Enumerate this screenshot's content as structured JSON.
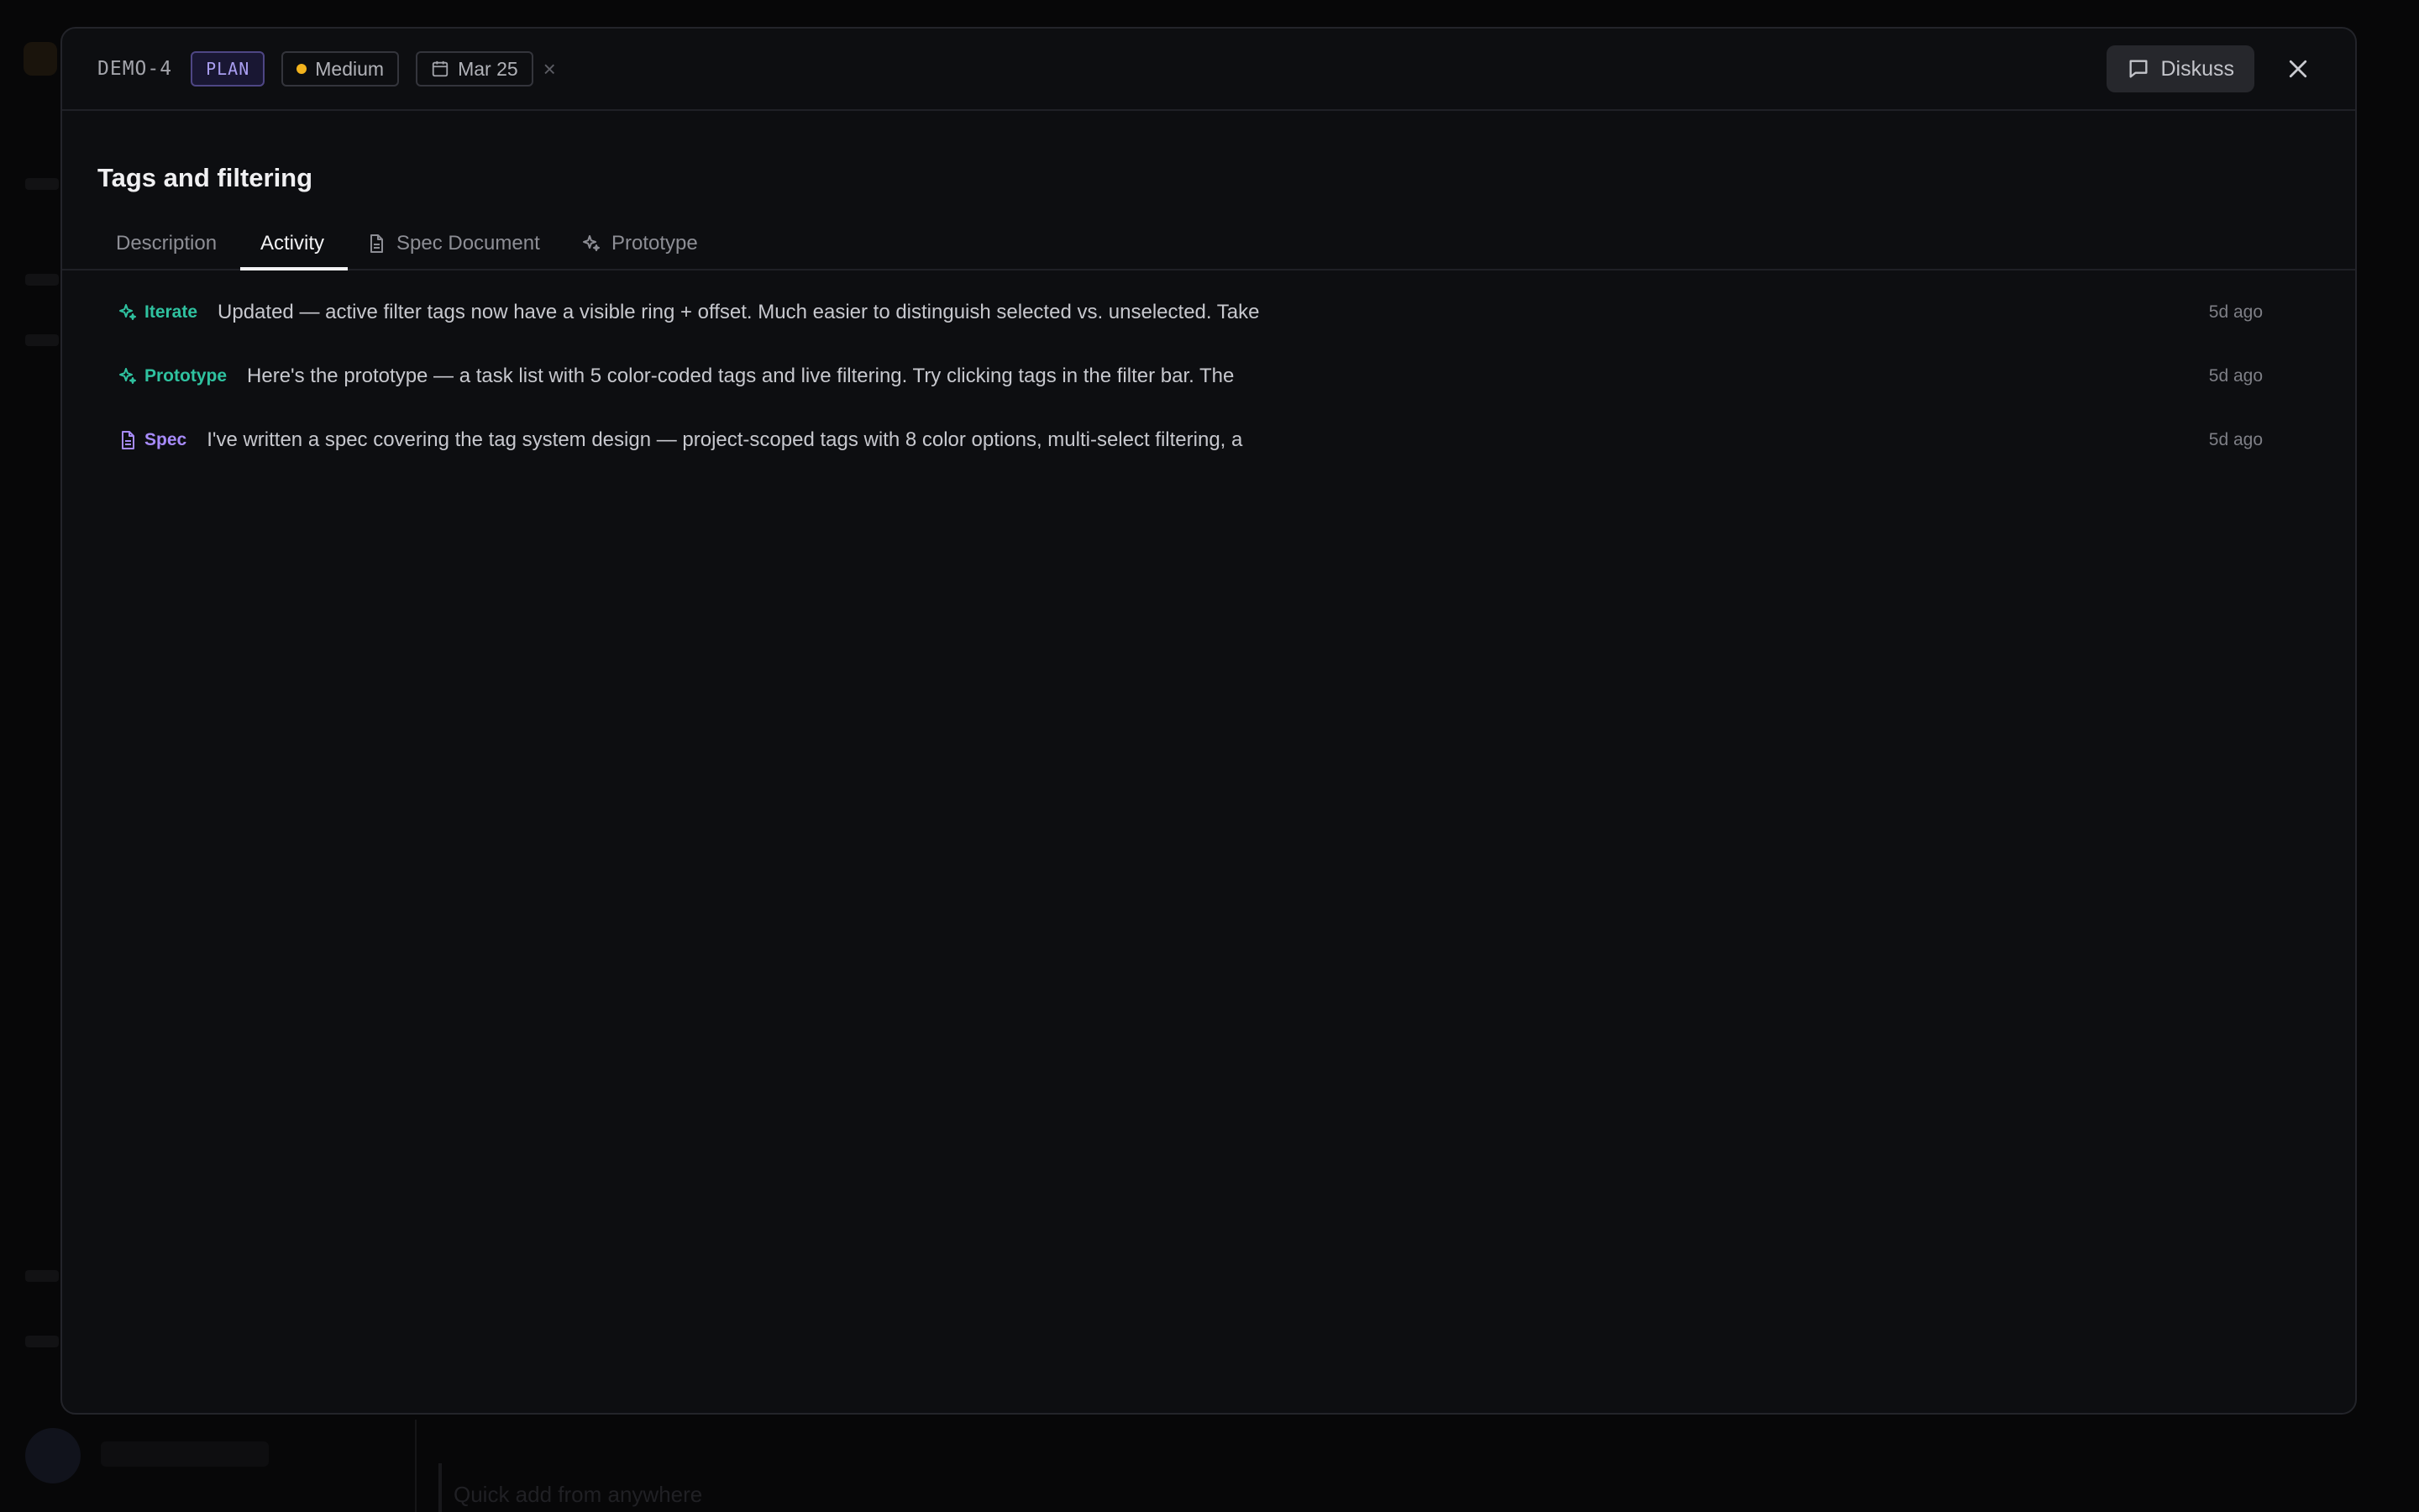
{
  "background": {
    "quick_add_text": "Quick add from anywhere"
  },
  "modal": {
    "issue_id": "DEMO-4",
    "stage_badge": "PLAN",
    "priority": {
      "label": "Medium",
      "color": "#f2b31d"
    },
    "due_date": {
      "label": "Mar 25",
      "icon": "calendar-icon",
      "clear_symbol": "×"
    },
    "discuss_button": {
      "label": "Diskuss",
      "icon": "message-square-icon"
    },
    "close_icon": "close-icon",
    "title": "Tags and filtering",
    "tabs": [
      {
        "label": "Description",
        "icon": null,
        "active": false
      },
      {
        "label": "Activity",
        "icon": null,
        "active": true
      },
      {
        "label": "Spec Document",
        "icon": "document-icon",
        "active": false
      },
      {
        "label": "Prototype",
        "icon": "sparkles-icon",
        "active": false
      }
    ],
    "activity": [
      {
        "type": "Iterate",
        "icon": "sparkles-icon",
        "color": "#2fc2a0",
        "text": "Updated — active filter tags now have a visible ring + offset. Much easier to distinguish selected vs. unselected. Take",
        "time": "5d ago"
      },
      {
        "type": "Prototype",
        "icon": "sparkles-icon",
        "color": "#2fc2a0",
        "text": "Here's the prototype — a task list with 5 color-coded tags and live filtering. Try clicking tags in the filter bar. The",
        "time": "5d ago"
      },
      {
        "type": "Spec",
        "icon": "document-icon",
        "color": "#a78bfa",
        "text": "I've written a spec covering the tag system design — project-scoped tags with 8 color options, multi-select filtering, a",
        "time": "5d ago"
      }
    ]
  }
}
